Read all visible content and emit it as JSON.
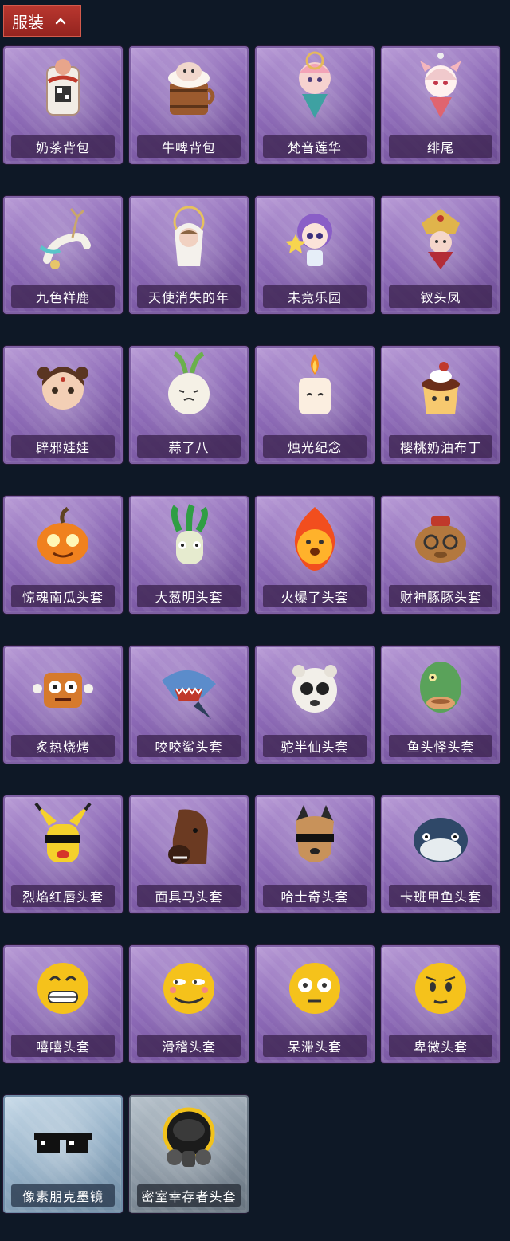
{
  "section": {
    "title": "服装"
  },
  "items": [
    {
      "label": "奶茶背包",
      "icon": "milk-tea-backpack-icon",
      "rarity": "purple"
    },
    {
      "label": "牛啤背包",
      "icon": "beer-barrel-backpack-icon",
      "rarity": "purple"
    },
    {
      "label": "梵音莲华",
      "icon": "lotus-fairy-doll-icon",
      "rarity": "purple"
    },
    {
      "label": "绯尾",
      "icon": "fox-girl-doll-icon",
      "rarity": "purple"
    },
    {
      "label": "九色祥鹿",
      "icon": "deer-charm-icon",
      "rarity": "purple"
    },
    {
      "label": "天使消失的年",
      "icon": "angel-doll-icon",
      "rarity": "purple"
    },
    {
      "label": "未竟乐园",
      "icon": "star-girl-doll-icon",
      "rarity": "purple"
    },
    {
      "label": "钗头凤",
      "icon": "phoenix-crown-doll-icon",
      "rarity": "purple"
    },
    {
      "label": "辟邪娃娃",
      "icon": "doll-head-icon",
      "rarity": "purple"
    },
    {
      "label": "蒜了八",
      "icon": "garlic-icon",
      "rarity": "purple"
    },
    {
      "label": "烛光纪念",
      "icon": "candle-icon",
      "rarity": "purple"
    },
    {
      "label": "樱桃奶油布丁",
      "icon": "pudding-icon",
      "rarity": "purple"
    },
    {
      "label": "惊魂南瓜头套",
      "icon": "pumpkin-mask-icon",
      "rarity": "purple"
    },
    {
      "label": "大葱明头套",
      "icon": "scallion-mask-icon",
      "rarity": "purple"
    },
    {
      "label": "火爆了头套",
      "icon": "fire-mask-icon",
      "rarity": "purple"
    },
    {
      "label": "财神豚豚头套",
      "icon": "capybara-mask-icon",
      "rarity": "purple"
    },
    {
      "label": "炙热烧烤",
      "icon": "bbq-meat-icon",
      "rarity": "purple"
    },
    {
      "label": "咬咬鲨头套",
      "icon": "shark-mask-icon",
      "rarity": "purple"
    },
    {
      "label": "驼半仙头套",
      "icon": "alpaca-mask-icon",
      "rarity": "purple"
    },
    {
      "label": "鱼头怪头套",
      "icon": "fish-head-mask-icon",
      "rarity": "purple"
    },
    {
      "label": "烈焰红唇头套",
      "icon": "yellow-mouse-mask-icon",
      "rarity": "purple"
    },
    {
      "label": "面具马头套",
      "icon": "horse-mask-icon",
      "rarity": "purple"
    },
    {
      "label": "哈士奇头套",
      "icon": "husky-mask-icon",
      "rarity": "purple"
    },
    {
      "label": "卡班甲鱼头套",
      "icon": "pufferfish-mask-icon",
      "rarity": "purple"
    },
    {
      "label": "嘻嘻头套",
      "icon": "grin-emoji-mask-icon",
      "rarity": "purple"
    },
    {
      "label": "滑稽头套",
      "icon": "funny-emoji-mask-icon",
      "rarity": "purple"
    },
    {
      "label": "呆滞头套",
      "icon": "dazed-emoji-mask-icon",
      "rarity": "purple"
    },
    {
      "label": "卑微头套",
      "icon": "humble-emoji-mask-icon",
      "rarity": "purple"
    },
    {
      "label": "像素朋克墨镜",
      "icon": "pixel-sunglasses-icon",
      "rarity": "blue"
    },
    {
      "label": "密室幸存者头套",
      "icon": "gas-mask-helmet-icon",
      "rarity": "gray"
    }
  ],
  "colors": {
    "background": "#0e1826",
    "tab": "#a52d27",
    "purple_card": "#8d6ab7",
    "blue_card": "#93afc6",
    "gray_card": "#8c99a5"
  }
}
